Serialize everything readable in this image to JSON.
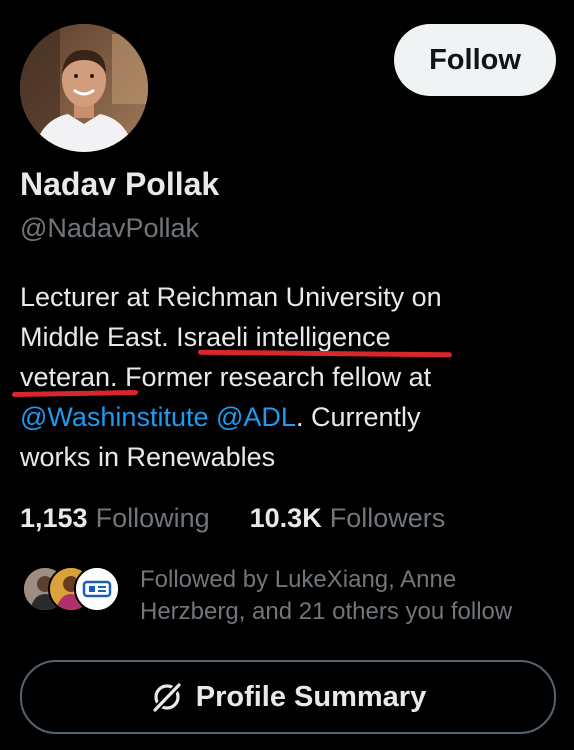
{
  "profile": {
    "display_name": "Nadav Pollak",
    "handle": "@NadavPollak",
    "follow_label": "Follow"
  },
  "bio": {
    "line1": "Lecturer at Reichman University on",
    "line2_a": "Middle East. ",
    "line2_b": "Israeli intelligence",
    "line3_a": "veteran.",
    "line3_b": " Former research fellow at",
    "mention1": "@Washinstitute",
    "mention2": "@ADL",
    "line4_c": ". Currently",
    "line5": "works in Renewables"
  },
  "stats": {
    "following_count": "1,153",
    "following_label": "Following",
    "followers_count": "10.3K",
    "followers_label": "Followers"
  },
  "followed_by": {
    "line1": "Followed by LukeXiang, Anne",
    "line2": "Herzberg, and 21 others you follow"
  },
  "summary_button": {
    "label": "Profile Summary",
    "icon": "grok-slash-icon"
  },
  "colors": {
    "background": "#000000",
    "primary_text": "#e7e9ea",
    "secondary_text": "#71767b",
    "link": "#1d9bf0",
    "follow_button_bg": "#eff3f4",
    "annotation_underline": "#d8262b"
  }
}
